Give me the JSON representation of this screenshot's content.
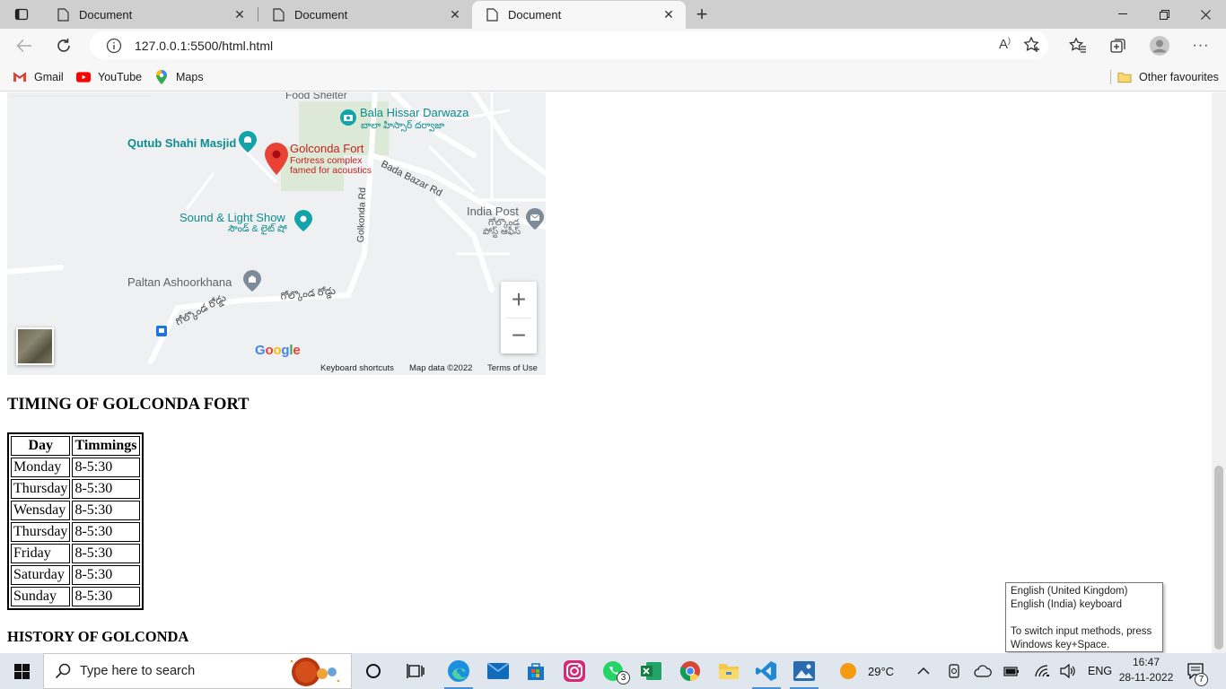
{
  "browser": {
    "tabs": [
      {
        "title": "Document",
        "active": false
      },
      {
        "title": "Document",
        "active": false
      },
      {
        "title": "Document",
        "active": true
      }
    ],
    "url": "127.0.0.1:5500/html.html",
    "bookmarks": [
      {
        "label": "Gmail",
        "icon": "gmail-icon"
      },
      {
        "label": "YouTube",
        "icon": "youtube-icon"
      },
      {
        "label": "Maps",
        "icon": "maps-icon"
      }
    ],
    "other_favourites": "Other favourites"
  },
  "map": {
    "labels": {
      "food_shelter": "Food Shelter",
      "bala_hissar": "Bala Hissar Darwaza",
      "bala_hissar_te": "బాలా హిస్సార్ దర్వాజా",
      "qutub": "Qutub Shahi Masjid",
      "golconda": "Golconda Fort",
      "golconda_sub1": "Fortress complex",
      "golconda_sub2": "famed for acoustics",
      "bada_bazar": "Bada Bazar Rd",
      "golconda_rd": "Golkonda Rd",
      "india_post": "India Post",
      "india_post_te1": "గోల్కొండ",
      "india_post_te2": "పోస్ట్ ఆఫీస్",
      "sound_light": "Sound & Light Show",
      "sound_light_te": "సౌండ్ & లైట్ షో",
      "paltan": "Paltan Ashoorkhana",
      "road_te1": "గోల్కొండ రోడ్డు",
      "road_te2": "గోల్కొండ రోడ్డు"
    },
    "zoom_in": "+",
    "zoom_out": "−",
    "google": "Google",
    "footer": {
      "shortcuts": "Keyboard shortcuts",
      "map_data": "Map data ©2022",
      "terms": "Terms of Use"
    }
  },
  "timing": {
    "heading": "TIMING OF GOLCONDA FORT",
    "columns": [
      "Day",
      "Timmings"
    ],
    "rows": [
      [
        "Monday",
        "8-5:30"
      ],
      [
        "Thursday",
        "8-5:30"
      ],
      [
        "Wensday",
        "8-5:30"
      ],
      [
        "Thursday",
        "8-5:30"
      ],
      [
        "Friday",
        "8-5:30"
      ],
      [
        "Saturday",
        "8-5:30"
      ],
      [
        "Sunday",
        "8-5:30"
      ]
    ]
  },
  "history_heading": "HISTORY OF GOLCONDA",
  "tooltip": {
    "line1": "English (United Kingdom)",
    "line2": "English (India) keyboard",
    "line3": "To switch input methods, press",
    "line4": "Windows key+Space."
  },
  "taskbar": {
    "search_placeholder": "Type here to search",
    "whatsapp_badge": "3",
    "temperature": "29°C",
    "language": "ENG",
    "time": "16:47",
    "date": "28-11-2022",
    "notifications": "7"
  }
}
